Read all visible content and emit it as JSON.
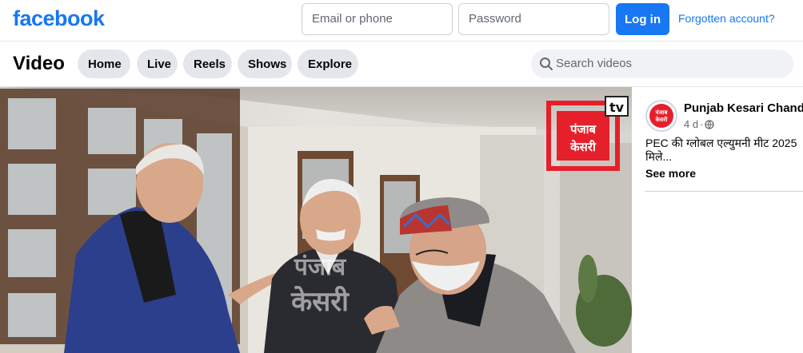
{
  "header": {
    "logo": "facebook",
    "email_placeholder": "Email or phone",
    "password_placeholder": "Password",
    "login_label": "Log in",
    "forgot_label": "Forgotten account?"
  },
  "video_nav": {
    "title": "Video",
    "tabs": [
      {
        "label": "Home"
      },
      {
        "label": "Live"
      },
      {
        "label": "Reels"
      },
      {
        "label": "Shows"
      },
      {
        "label": "Explore"
      }
    ],
    "search_placeholder": "Search videos",
    "search_icon": "search-icon"
  },
  "player": {
    "watermark_logo": [
      "पंजाब",
      "केसरी"
    ],
    "watermark_tv": "tv",
    "overlay_watermark": [
      "पंजाब",
      "केसरी"
    ]
  },
  "post": {
    "page_name": "Punjab Kesari Chandigarh",
    "age": "4 d",
    "separator": "·",
    "audience_icon": "globe-icon",
    "text_line1": "PEC की ग्लोबल एल्युमनी मीट 2025",
    "text_line2": "मिले...",
    "see_more_label": "See more",
    "avatar_text": [
      "पंजाब",
      "केसरी"
    ]
  },
  "colors": {
    "brand_blue": "#1877f2",
    "pill_bg": "#e4e6eb",
    "search_bg": "#f0f2f5",
    "watermark_red": "#e5202a"
  }
}
